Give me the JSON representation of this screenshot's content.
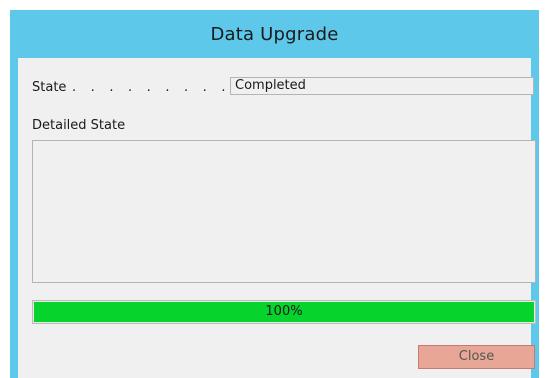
{
  "window": {
    "title": "Data Upgrade"
  },
  "form": {
    "state_label": "State",
    "state_dots": ". . . . . . . . . .",
    "state_value": "Completed",
    "detailed_state_label": "Detailed State",
    "detailed_state_value": ""
  },
  "progress": {
    "value": 1.0,
    "label": "100%"
  },
  "buttons": {
    "close_label": "Close"
  },
  "colors": {
    "title_bar": "#5ec8ea",
    "client_background": "#f0f0f0",
    "progress_fill": "#06d32c",
    "close_button": "#e8a696"
  }
}
